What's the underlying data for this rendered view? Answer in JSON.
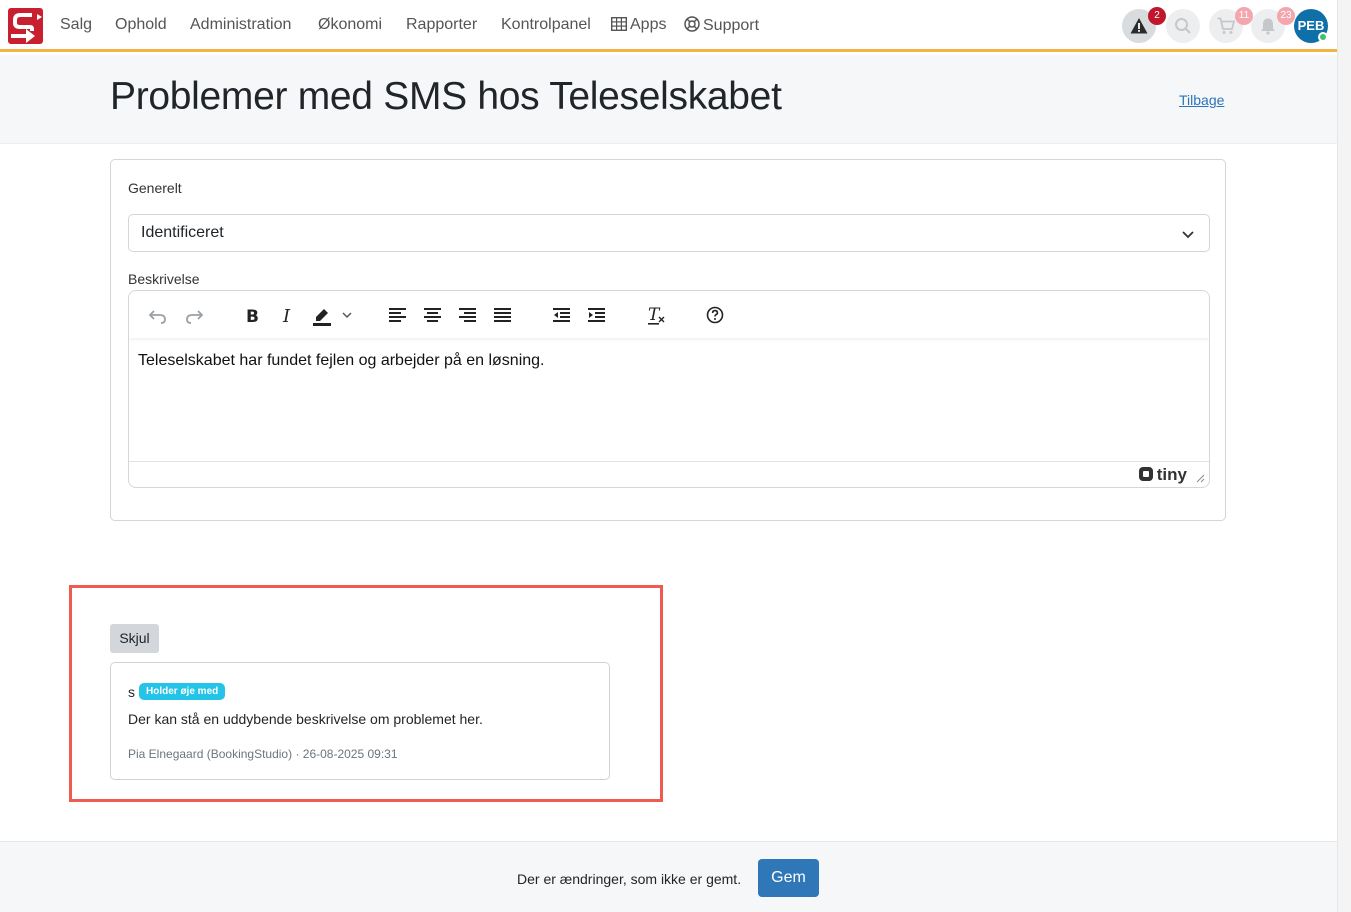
{
  "nav": {
    "items": [
      "Salg",
      "Ophold",
      "Administration",
      "Økonomi",
      "Rapporter",
      "Kontrolpanel"
    ],
    "apps_label": "Apps",
    "support_label": "Support",
    "alerts_badge": "2",
    "cart_badge": "11",
    "notifications_badge": "23",
    "avatar_initials": "PEB",
    "icons": {
      "logo": "logo-icon",
      "apps": "grid-icon",
      "support": "lifebuoy-icon",
      "alerts": "warning-icon",
      "search": "search-icon",
      "cart": "cart-icon",
      "notifications": "bell-icon"
    }
  },
  "header": {
    "title": "Problemer med SMS hos Teleselskabet",
    "back_link": "Tilbage"
  },
  "form": {
    "general_label": "Generelt",
    "status_value": "Identificeret",
    "description_label": "Beskrivelse",
    "editor_content": "Teleselskabet har fundet fejlen og arbejder på en løsning.",
    "editor_brand": "tiny",
    "toolbar_icons": [
      "undo-icon",
      "redo-icon",
      "bold-icon",
      "italic-icon",
      "highlight-icon",
      "align-left-icon",
      "align-center-icon",
      "align-right-icon",
      "justify-icon",
      "outdent-icon",
      "indent-icon",
      "clear-format-icon",
      "help-icon"
    ]
  },
  "notes": {
    "toggle_label": "Skjul",
    "items": [
      {
        "author_initial": "s",
        "badge": "Holder øje med",
        "text": "Der kan stå en uddybende beskrivelse om problemet her.",
        "meta": "Pia Elnegaard (BookingStudio) · 26-08-2025 09:31"
      }
    ]
  },
  "footer": {
    "unsaved_text": "Der er ændringer, som ikke er gemt.",
    "save_label": "Gem"
  },
  "colors": {
    "brand_red": "#c8202f",
    "nav_accent": "#f0b447",
    "primary": "#2f77b6",
    "badge_info": "#23c4e8",
    "highlight": "#ef5b50"
  }
}
